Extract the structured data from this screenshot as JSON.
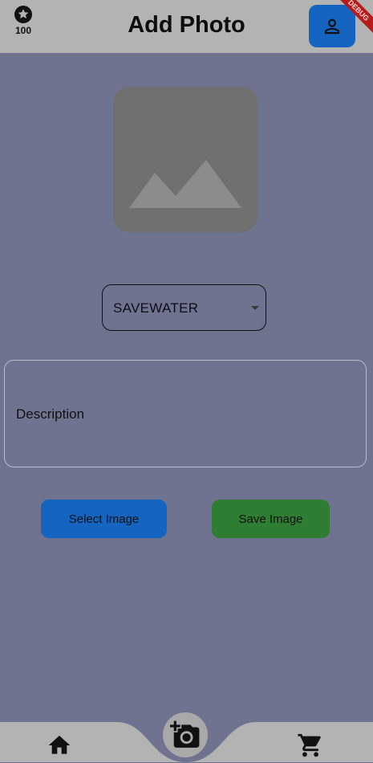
{
  "appbar": {
    "points": "100",
    "title": "Add Photo",
    "star_icon": "star-badge-icon",
    "profile_icon": "person-icon",
    "debug_banner": "DEBUG"
  },
  "photo": {
    "placeholder_icon": "image-placeholder-icon"
  },
  "category": {
    "value": "SAVEWATER",
    "caret_icon": "dropdown-caret-icon"
  },
  "description": {
    "placeholder": "Description"
  },
  "actions": {
    "select_label": "Select Image",
    "save_label": "Save Image"
  },
  "nav": {
    "home_icon": "home-icon",
    "camera_icon": "add-photo-icon",
    "cart_icon": "cart-icon"
  },
  "colors": {
    "background": "#6f7390",
    "appbar": "#b3b3b3",
    "primary": "#1565c0",
    "success": "#2e7d32",
    "placeholder": "#707070"
  }
}
